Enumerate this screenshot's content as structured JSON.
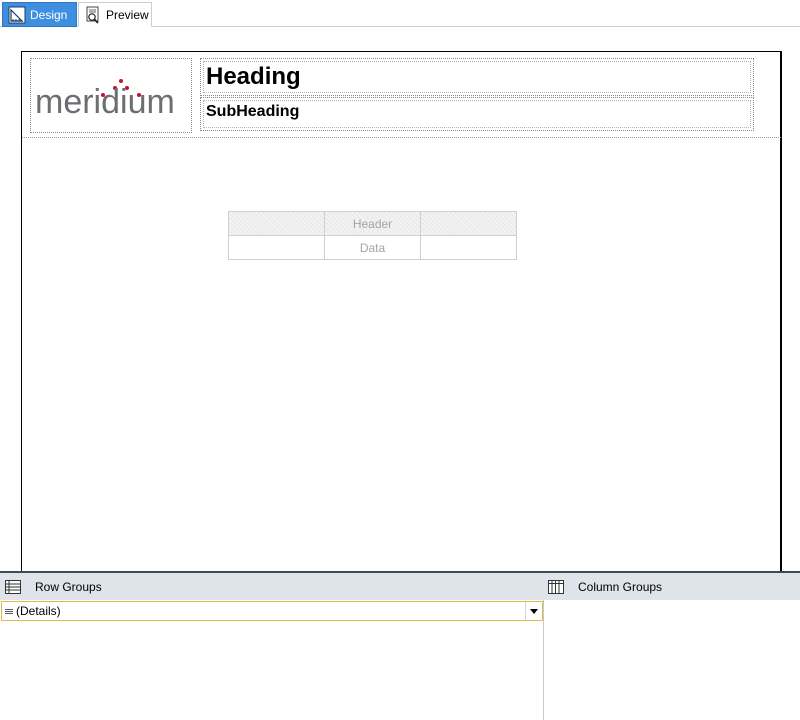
{
  "tabs": [
    {
      "label": "Design",
      "active": true,
      "icon": "design-icon"
    },
    {
      "label": "Preview",
      "active": false,
      "icon": "preview-icon"
    }
  ],
  "report": {
    "logo_text": "meridium",
    "heading": "Heading",
    "subheading": "SubHeading",
    "table": {
      "header_row": [
        "",
        "Header",
        ""
      ],
      "data_row": [
        "",
        "Data",
        ""
      ]
    }
  },
  "grouping": {
    "row_groups_label": "Row Groups",
    "column_groups_label": "Column Groups",
    "row_group_items": [
      "(Details)"
    ]
  },
  "colors": {
    "active_tab": "#3f8fe0",
    "logo_gray": "#6d6e71",
    "logo_dot_red": "#c8102e",
    "group_header_bg": "#dfe3ea",
    "selected_group_border": "#e0b84d"
  }
}
